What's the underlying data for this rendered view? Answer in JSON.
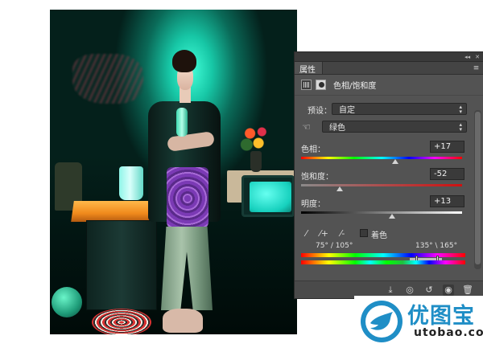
{
  "panel": {
    "tab_label": "属性",
    "collapse_glyph": "◂◂",
    "close_glyph": "✕",
    "menu_glyph": "≡",
    "adjustment_title": "色相/饱和度",
    "preset_label": "预设：",
    "preset_value": "自定",
    "channel_value": "绿色",
    "hue_label": "色相：",
    "hue_value": "+17",
    "hue_fraction": 0.585,
    "saturation_label": "饱和度：",
    "saturation_value": "-52",
    "saturation_fraction": 0.24,
    "lightness_label": "明度：",
    "lightness_value": "+13",
    "lightness_fraction": 0.565,
    "colorize_label": "着色",
    "range_left": "75° / 105°",
    "range_right": "135° \\ 165°"
  },
  "icons": {
    "hue_sat": "hue-saturation-icon",
    "mask": "layer-mask-icon",
    "hand": "targeted-adjustment-hand-icon",
    "eyedropper": "eyedropper-icon",
    "eyedropper_plus": "eyedropper-plus-icon",
    "eyedropper_minus": "eyedropper-minus-icon",
    "clip": "clip-to-layer-icon",
    "view_previous": "view-previous-state-icon",
    "reset": "reset-icon",
    "visibility": "eye-icon",
    "trash": "trash-icon"
  },
  "watermark": {
    "title": "优图宝",
    "domain": "utobao.com"
  }
}
